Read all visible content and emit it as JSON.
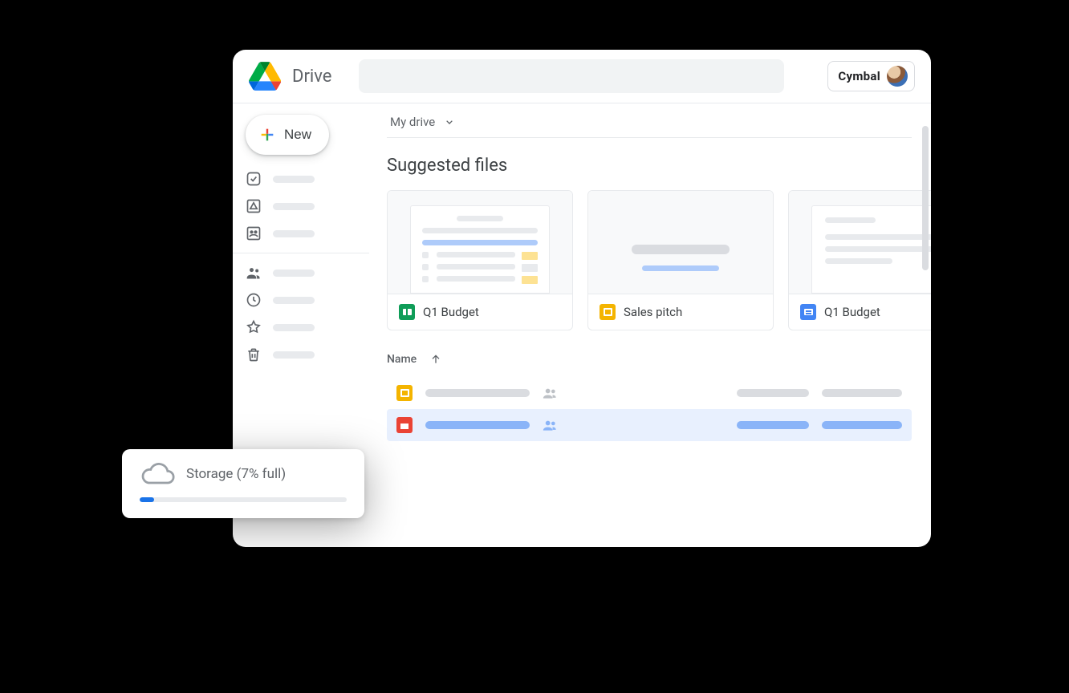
{
  "header": {
    "app_title": "Drive",
    "account_name": "Cymbal"
  },
  "sidebar": {
    "new_label": "New"
  },
  "breadcrumb": {
    "label": "My drive"
  },
  "suggested": {
    "title": "Suggested files",
    "cards": [
      {
        "name": "Q1 Budget",
        "type": "sheets"
      },
      {
        "name": "Sales pitch",
        "type": "slides"
      },
      {
        "name": "Q1 Budget",
        "type": "docs"
      }
    ]
  },
  "list": {
    "column_name": "Name"
  },
  "storage": {
    "label": "Storage (7% full)",
    "percent": 7
  }
}
